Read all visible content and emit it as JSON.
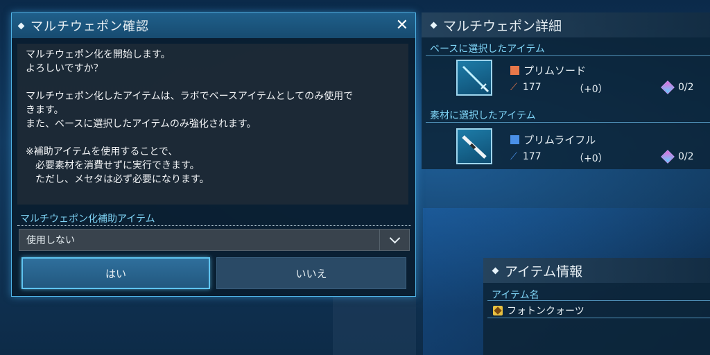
{
  "confirm_dialog": {
    "title": "マルチウェポン確認",
    "close_glyph": "✕",
    "message": "マルチウェポン化を開始します。\nよろしいですか？\n\nマルチウェポン化したアイテムは、ラボでベースアイテムとしてのみ使用で\nきます。\nまた、ベースに選択したアイテムのみ強化されます。\n\n※補助アイテムを使用することで、\n　必要素材を消費せずに実行できます。\n　ただし、メセタは必ず必要になります。",
    "assist_label": "マルチウェポン化補助アイテム",
    "assist_selected": "使用しない",
    "yes_label": "はい",
    "no_label": "いいえ"
  },
  "detail_panel": {
    "title": "マルチウェポン詳細",
    "base_header": "ベースに選択したアイテム",
    "base_item": {
      "name": "プリムソード",
      "power": "177",
      "grind": "（+0）",
      "slots": "0/2",
      "icon": "sword-icon",
      "badge_color": "#e8784a"
    },
    "material_header": "素材に選択したアイテム",
    "material_item": {
      "name": "プリムライフル",
      "power": "177",
      "grind": "（+0）",
      "slots": "0/2",
      "icon": "rifle-icon",
      "badge_color": "#4a90e8"
    }
  },
  "info_panel": {
    "title": "アイテム情報",
    "name_header": "アイテム名",
    "item_name": "フォトンクォーツ",
    "icon": "photon-quartz-icon"
  },
  "colors": {
    "accent": "#4fb3e6",
    "heading": "#7fd4f6"
  }
}
